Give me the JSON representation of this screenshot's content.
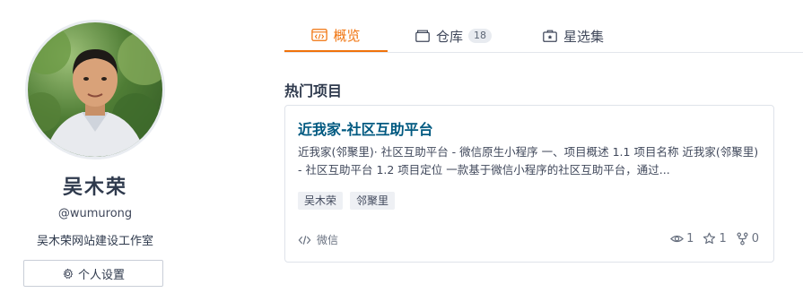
{
  "profile": {
    "name": "吴木荣",
    "handle": "@wumurong",
    "bio": "吴木荣网站建设工作室",
    "settings_label": "个人设置"
  },
  "tabs": [
    {
      "label": "概览",
      "icon": "code-icon",
      "active": true
    },
    {
      "label": "仓库",
      "icon": "repo-icon",
      "count": "18"
    },
    {
      "label": "星选集",
      "icon": "collection-icon"
    }
  ],
  "section_title": "热门项目",
  "project": {
    "title": "近我家-社区互助平台",
    "description": "近我家(邻聚里)· 社区互助平台 - 微信原生小程序 一、项目概述 1.1 项目名称 近我家(邻聚里) - 社区互助平台 1.2 项目定位 一款基于微信小程序的社区互助平台，通过...",
    "tags": [
      "吴木荣",
      "邻聚里"
    ],
    "language": "微信",
    "watchers": "1",
    "stars": "1",
    "forks": "0"
  },
  "colors": {
    "accent": "#f0720b",
    "link": "#005980"
  }
}
